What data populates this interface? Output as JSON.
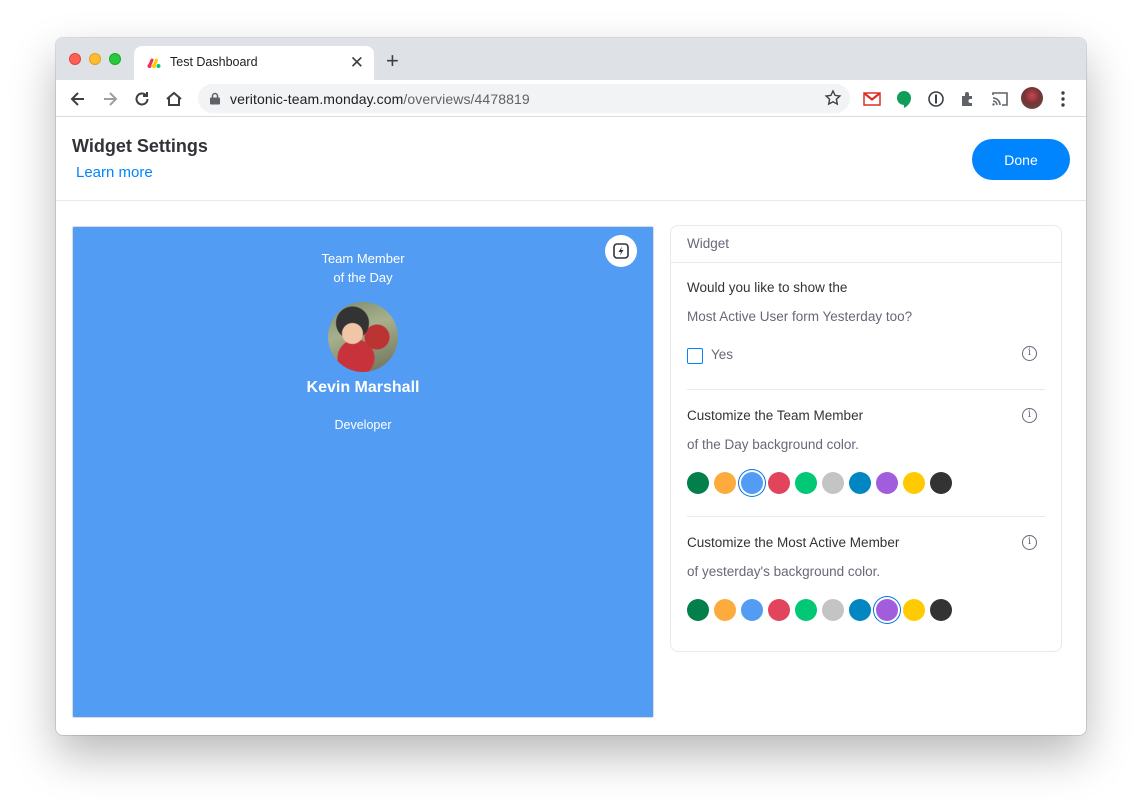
{
  "browser": {
    "tab_title": "Test Dashboard",
    "url_host": "veritonic-team.monday.com",
    "url_path": "/overviews/4478819"
  },
  "header": {
    "title": "Widget Settings",
    "learn_more": "Learn more",
    "done_label": "Done"
  },
  "preview": {
    "background_color": "#529cf3",
    "label_line1": "Team Member",
    "label_line2": "of the Day",
    "member_name": "Kevin Marshall",
    "member_role": "Developer"
  },
  "panel": {
    "title": "Widget",
    "question1": {
      "line1": "Would you like to show the",
      "line2": "Most Active User form Yesterday too?",
      "checkbox_label": "Yes",
      "checked": false
    },
    "question2": {
      "line1": "Customize the Team Member",
      "line2": "of the Day background color.",
      "selected_color": "#529cf3"
    },
    "question3": {
      "line1": "Customize the Most Active Member",
      "line2": "of yesterday's background color.",
      "selected_color": "#a25ddc"
    }
  },
  "palette": [
    "#037f4c",
    "#fdab3d",
    "#529cf3",
    "#e2445c",
    "#00c875",
    "#c4c4c4",
    "#0086c0",
    "#a25ddc",
    "#ffcb00",
    "#333333"
  ]
}
